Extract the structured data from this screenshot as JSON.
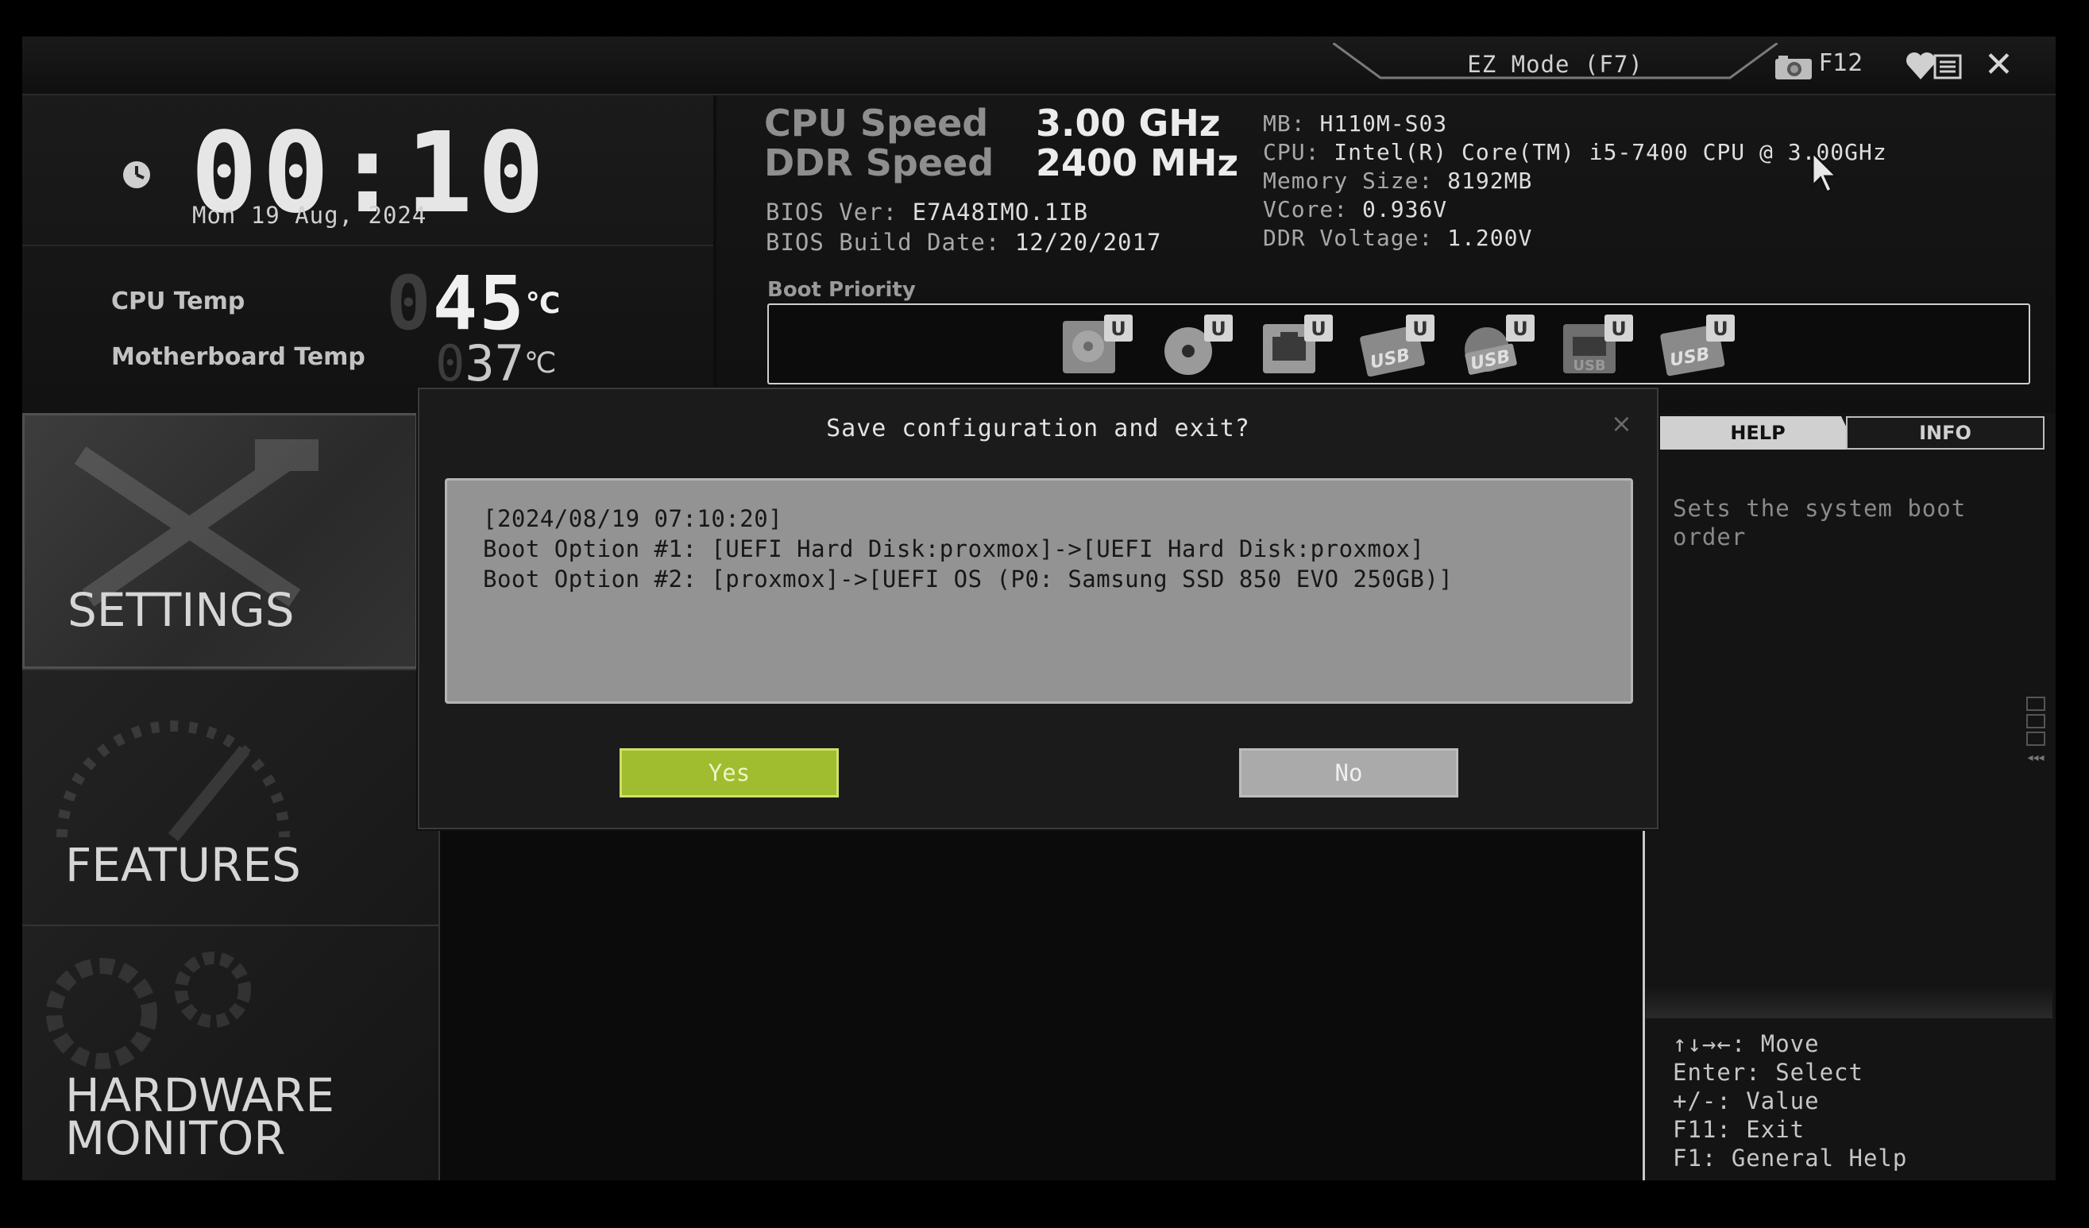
{
  "header": {
    "ez_mode_label": "EZ Mode (F7)",
    "screenshot_key": "F12"
  },
  "clock": {
    "time": "00:10",
    "date": "Mon  19 Aug, 2024"
  },
  "temps": {
    "cpu_label": "CPU Temp",
    "cpu_value": "45",
    "mb_label": "Motherboard Temp",
    "mb_value": "37",
    "unit": "℃"
  },
  "speeds": {
    "cpu_label": "CPU Speed",
    "cpu_value": "3.00 GHz",
    "ddr_label": "DDR Speed",
    "ddr_value": "2400 MHz"
  },
  "bios": {
    "ver_label": "BIOS Ver:",
    "ver_value": "E7A48IMO.1IB",
    "date_label": "BIOS Build Date:",
    "date_value": "12/20/2017"
  },
  "system": {
    "mb_label": "MB:",
    "mb_value": "H110M-S03",
    "cpu_label": "CPU:",
    "cpu_value": "Intel(R) Core(TM) i5-7400 CPU @ 3.00GHz",
    "mem_label": "Memory Size:",
    "mem_value": "8192MB",
    "vcore_label": "VCore:",
    "vcore_value": "0.936V",
    "ddrv_label": "DDR Voltage:",
    "ddrv_value": "1.200V"
  },
  "boot_priority": {
    "title": "Boot Priority",
    "devices": [
      {
        "icon": "hard-disk-icon",
        "badge": "U"
      },
      {
        "icon": "optical-disc-icon",
        "badge": "U"
      },
      {
        "icon": "network-icon",
        "badge": "U"
      },
      {
        "icon": "usb-drive-icon",
        "badge": "U",
        "label": "USB"
      },
      {
        "icon": "usb-disc-icon",
        "badge": "U",
        "label": "USB"
      },
      {
        "icon": "usb-key-icon",
        "badge": "U",
        "label": "USB"
      },
      {
        "icon": "usb-floppy-icon",
        "badge": "U",
        "label": "USB"
      }
    ]
  },
  "menu": {
    "settings": "SETTINGS",
    "features": "FEATURES",
    "hw_line1": "HARDWARE",
    "hw_line2": "MONITOR"
  },
  "right_panel": {
    "tab_help": "HELP",
    "tab_info": "INFO",
    "help_text": "Sets the system boot order",
    "keys": [
      "↑↓→←: Move",
      "Enter: Select",
      "+/-: Value",
      "F11: Exit",
      "F1: General Help"
    ]
  },
  "dialog": {
    "title": "Save configuration and exit?",
    "close": "×",
    "lines": [
      "[2024/08/19 07:10:20]",
      "Boot Option #1: [UEFI Hard Disk:proxmox]->[UEFI Hard Disk:proxmox]",
      "Boot Option #2: [proxmox]->[UEFI OS (P0: Samsung SSD 850 EVO 250GB)]"
    ],
    "yes_label": "Yes",
    "no_label": "No"
  },
  "colors": {
    "yes_button": "#9fbd2e",
    "no_button": "#aaaaaa",
    "dialog_box": "#939393"
  }
}
